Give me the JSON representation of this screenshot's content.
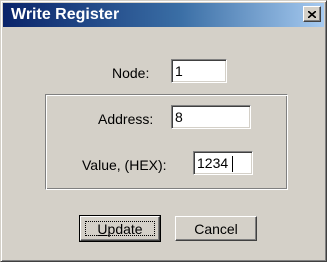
{
  "window": {
    "title": "Write Register",
    "close_icon": "close-icon"
  },
  "form": {
    "node_label": "Node:",
    "node_value": "1",
    "address_label": "Address:",
    "address_value": "8",
    "value_label": "Value, (HEX):",
    "value_value": "1234"
  },
  "buttons": {
    "update_mnemonic": "U",
    "update_rest": "pdate",
    "cancel_label": "Cancel"
  }
}
